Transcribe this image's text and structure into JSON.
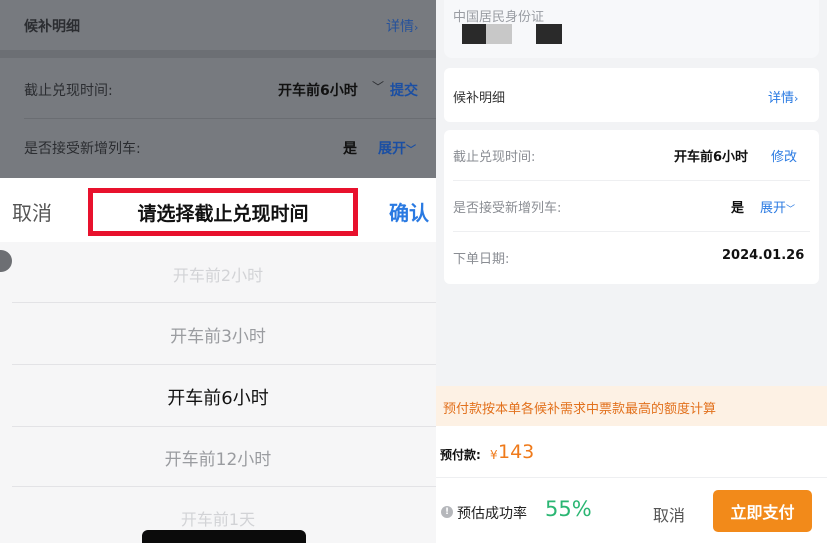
{
  "left": {
    "bg_rows": {
      "waitlist_detail": "候补明细",
      "detail_link": "详情",
      "deadline_label": "截止兑现时间:",
      "deadline_value": "开车前6小时",
      "submit_link": "提交",
      "accept_new_label": "是否接受新增列车:",
      "accept_new_value": "是",
      "expand_link": "展开"
    },
    "picker": {
      "cancel": "取消",
      "title": "请选择截止兑现时间",
      "confirm": "确认",
      "options": [
        "开车前2小时",
        "开车前3小时",
        "开车前6小时",
        "开车前12小时",
        "开车前1天"
      ],
      "selected_index": 2
    }
  },
  "right": {
    "id_type": "中国居民身份证",
    "waitlist_detail": "候补明细",
    "detail_link": "详情",
    "deadline_label": "截止兑现时间:",
    "deadline_value": "开车前6小时",
    "modify_link": "修改",
    "accept_new_label": "是否接受新增列车:",
    "accept_new_value": "是",
    "expand_link": "展开",
    "order_date_label": "下单日期:",
    "order_date_value": "2024.01.26",
    "notice": "预付款按本单各候补需求中票款最高的额度计算",
    "prepay_label": "预付款:",
    "currency": "¥",
    "prepay_amount": "143",
    "success_rate_label": "预估成功率",
    "success_rate_value": "55%",
    "cancel": "取消",
    "pay_now": "立即支付"
  },
  "colors": {
    "accent_blue": "#2a7ae2",
    "orange": "#f28a1a",
    "green": "#2bb673",
    "highlight_red": "#e8112d"
  }
}
